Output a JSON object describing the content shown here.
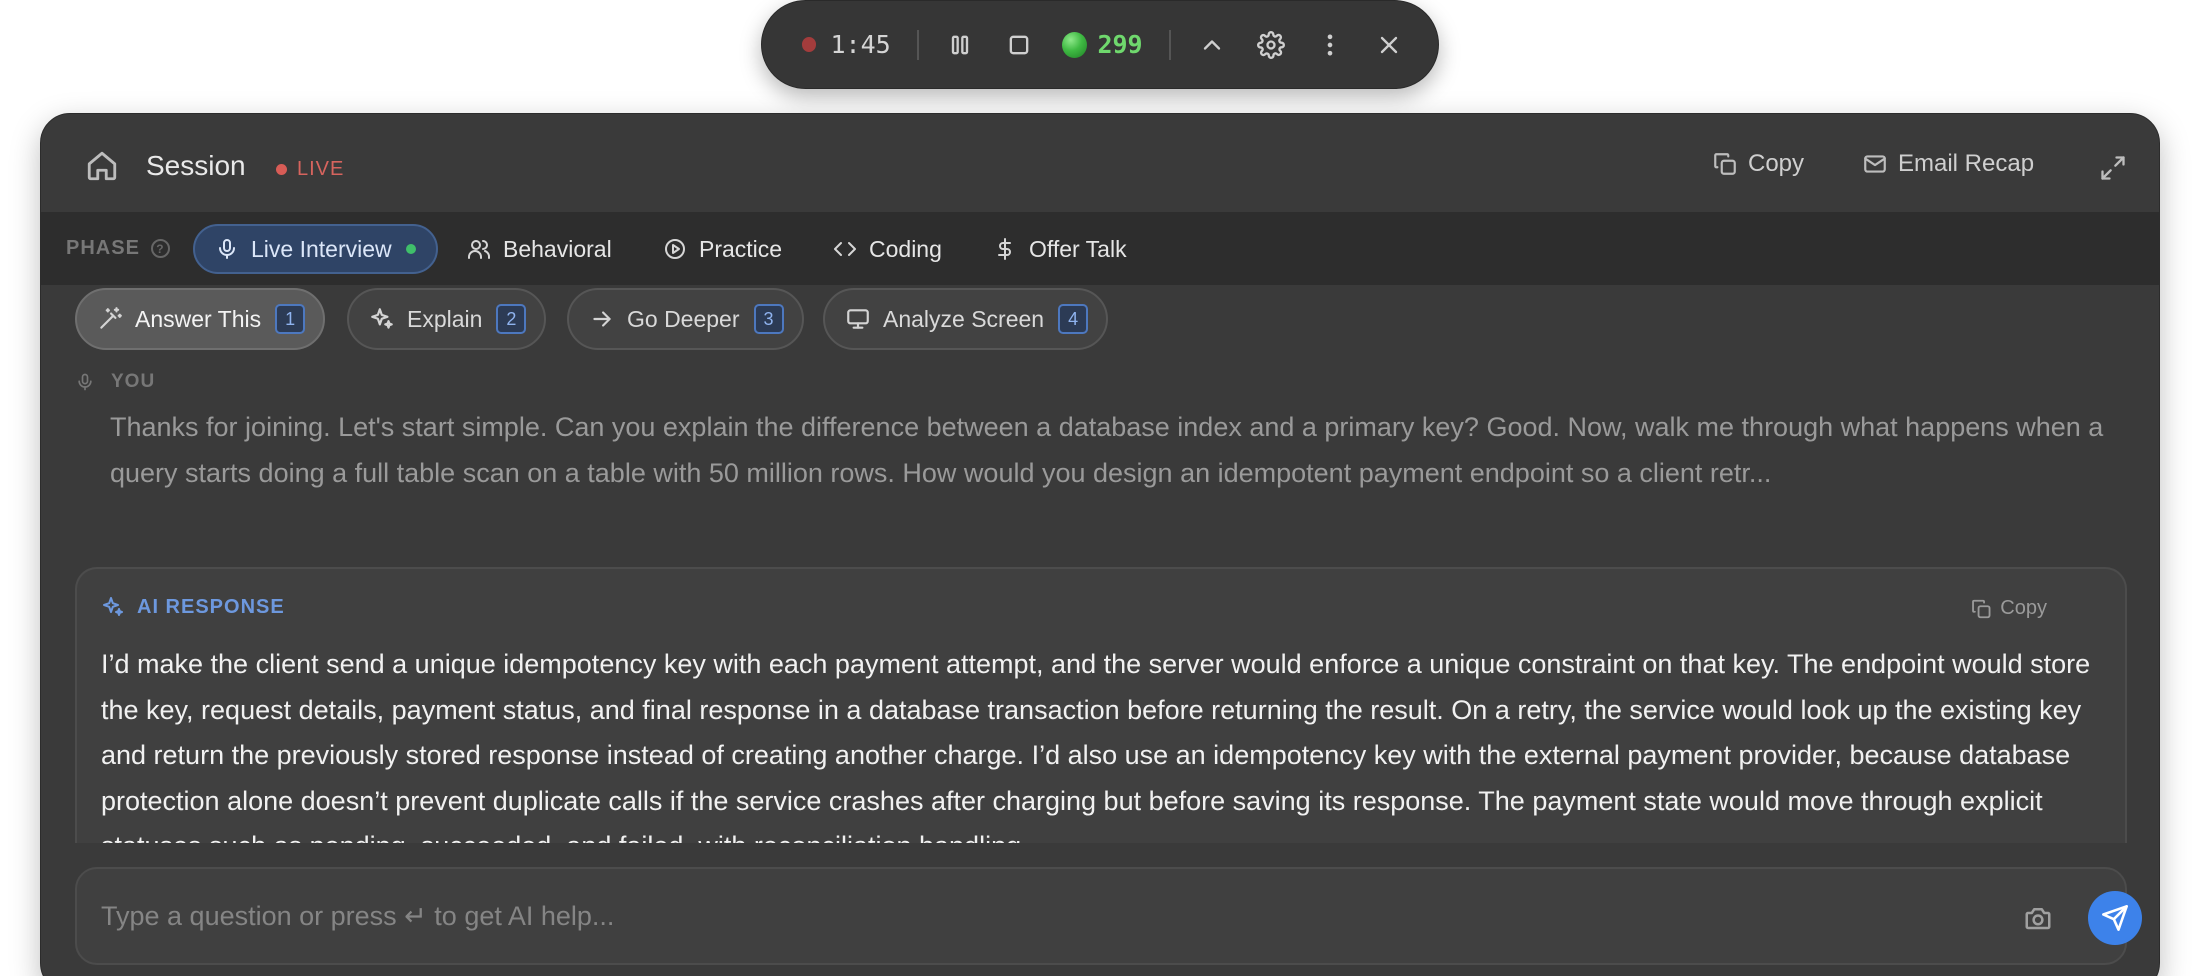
{
  "recorder": {
    "elapsed": "1:45",
    "score": "299"
  },
  "header": {
    "title": "Session",
    "status": "LIVE",
    "copy_label": "Copy",
    "email_label": "Email Recap"
  },
  "phase": {
    "label": "PHASE",
    "help": "?",
    "tabs": [
      {
        "label": "Live Interview",
        "icon": "microphone-icon",
        "active": true
      },
      {
        "label": "Behavioral",
        "icon": "users-icon"
      },
      {
        "label": "Practice",
        "icon": "play-circle-icon"
      },
      {
        "label": "Coding",
        "icon": "code-icon"
      },
      {
        "label": "Offer Talk",
        "icon": "dollar-icon"
      }
    ]
  },
  "quick_actions": [
    {
      "label": "Answer This",
      "shortcut": "1",
      "icon": "magic-wand-icon",
      "active": true
    },
    {
      "label": "Explain",
      "shortcut": "2",
      "icon": "sparkles-icon"
    },
    {
      "label": "Go Deeper",
      "shortcut": "3",
      "icon": "arrow-right-icon"
    },
    {
      "label": "Analyze Screen",
      "shortcut": "4",
      "icon": "monitor-icon"
    }
  ],
  "transcript": {
    "speaker": "YOU",
    "text": "Thanks for joining. Let's start simple. Can you explain the difference between a database index and a primary key? Good. Now, walk me through what happens when a query starts doing a full table scan on a table with 50 million rows. How would you design an idempotent payment endpoint so a client retr..."
  },
  "ai_response": {
    "label": "AI RESPONSE",
    "copy_label": "Copy",
    "text": "I’d make the client send a unique idempotency key with each payment attempt, and the server would enforce a unique constraint on that key. The endpoint would store the key, request details, payment status, and final response in a database transaction before returning the result. On a retry, the service would look up the existing key and return the previously stored response instead of creating another charge. I’d also use an idempotency key with the external payment provider, because database protection alone doesn’t prevent duplicate calls if the service crashes after charging but before saving its response. The payment state would move through explicit statuses such as pending, succeeded, and failed, with reconciliation handling"
  },
  "composer": {
    "placeholder": "Type a question or press ↵ to get AI help..."
  },
  "colors": {
    "accent": "#3d82ea",
    "live": "#d6645e",
    "score": "#6fd86d",
    "active_dot": "#3fbf6a"
  }
}
